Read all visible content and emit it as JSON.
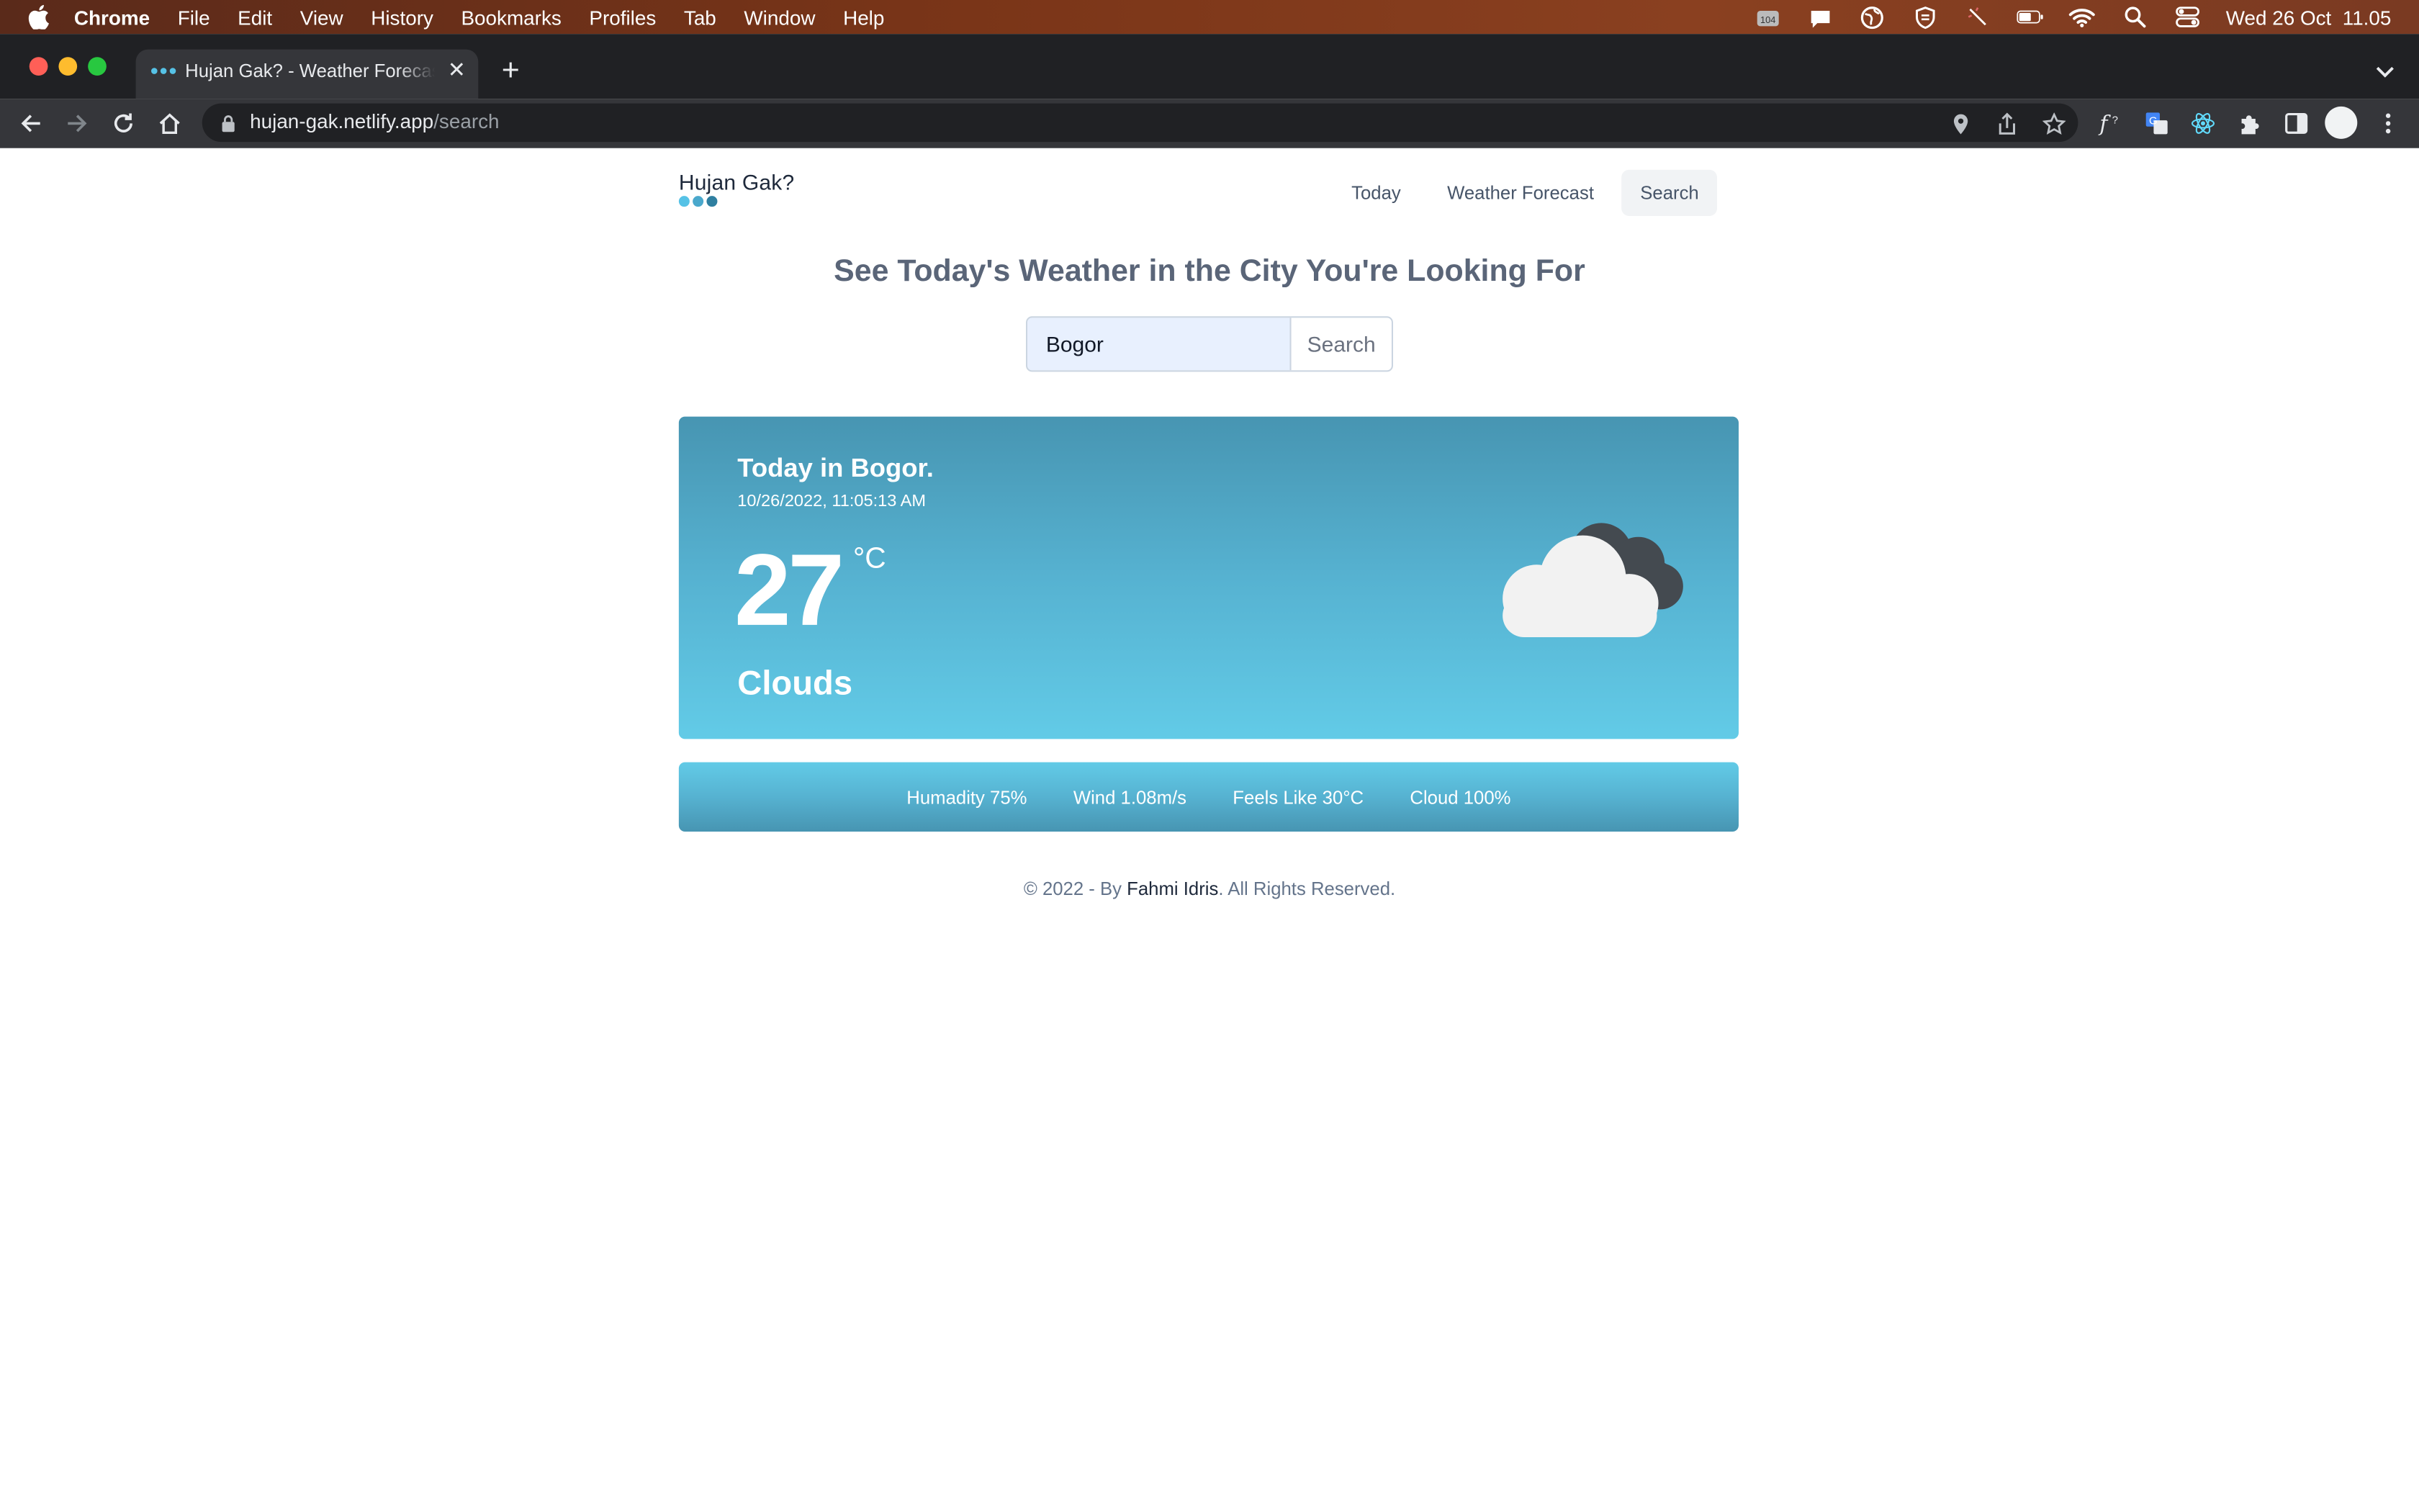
{
  "menubar": {
    "items": [
      "Chrome",
      "File",
      "Edit",
      "View",
      "History",
      "Bookmarks",
      "Profiles",
      "Tab",
      "Window",
      "Help"
    ],
    "clock": "Wed 26 Oct  11.05",
    "icons": [
      "fluent-icon",
      "notification-icon",
      "vpn-globe-icon",
      "shield-icon",
      "wand-icon",
      "battery-icon",
      "wifi-icon",
      "spotlight-icon",
      "control-center-icon"
    ]
  },
  "browser": {
    "tab_title": "Hujan Gak? - Weather Forecast",
    "url_host": "hujan-gak.netlify.app",
    "url_path": "/search"
  },
  "site": {
    "brand": "Hujan Gak?",
    "nav": {
      "today": "Today",
      "forecast": "Weather Forecast",
      "search": "Search"
    },
    "headline": "See Today's Weather in the City You're Looking For",
    "search": {
      "value": "Bogor",
      "button": "Search"
    },
    "weather": {
      "title": "Today in Bogor.",
      "datetime": "10/26/2022, 11:05:13 AM",
      "temperature": "27",
      "unit": "°C",
      "condition": "Clouds",
      "icon": "clouds-icon"
    },
    "stats": {
      "humidity": "Humadity 75%",
      "wind": "Wind 1.08m/s",
      "feels_like": "Feels Like 30°C",
      "cloud": "Cloud 100%"
    },
    "footer": {
      "prefix": "© 2022 - By ",
      "author": "Fahmi Idris",
      "suffix": ". All Rights Reserved."
    }
  },
  "colors": {
    "accent": "#56b2d1",
    "card_top": "#4795b2",
    "card_bottom": "#62cbe7",
    "brand_dot_1": "#56c2e6",
    "brand_dot_2": "#4aa8cc",
    "brand_dot_3": "#2f7fa0"
  }
}
